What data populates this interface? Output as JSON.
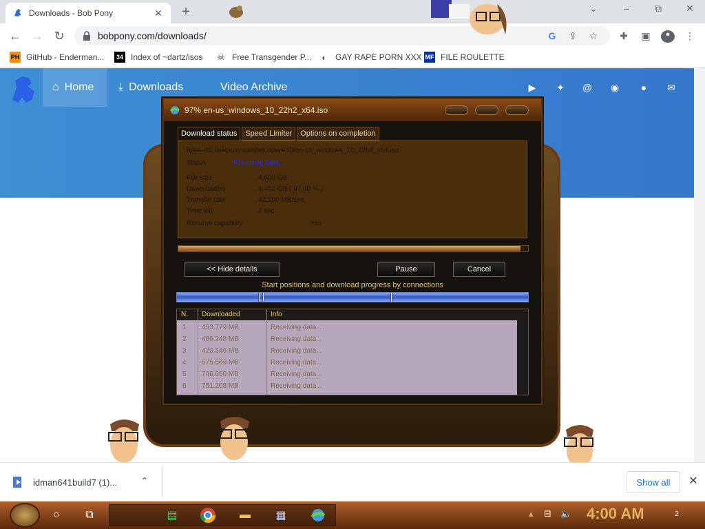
{
  "browser": {
    "tab_title": "Downloads - Bob Pony",
    "new_tab": "+",
    "window_controls": [
      "⌄",
      "–",
      "⧉",
      "✕"
    ],
    "url": "bobpony.com/downloads/",
    "bookmarks": [
      {
        "label": "GitHub - Enderman...",
        "icon": "PH",
        "icon_color": "#ff9000"
      },
      {
        "label": "Index of ~dartz/isos",
        "icon": "34",
        "icon_color": "#000000"
      },
      {
        "label": "Free Transgender P...",
        "icon": "☠",
        "icon_color": "#000000"
      },
      {
        "label": "GAY RAPE PORN XXX",
        "icon": "◐",
        "icon_color": "#5f6368"
      },
      {
        "label": "FILE ROULETTE",
        "icon": "MF",
        "icon_color": "#0033aa"
      }
    ]
  },
  "site": {
    "nav_home": "Home",
    "nav_downloads": "Downloads",
    "nav_archive": "Video Archive",
    "social_icons": [
      "youtube-icon",
      "twitter-icon",
      "mastodon-icon",
      "discord-icon",
      "github-icon",
      "mail-icon"
    ]
  },
  "idm": {
    "title": "97% en-us_windows_10_22h2_x64.iso",
    "tabs": [
      "Download status",
      "Speed Limiter",
      "Options on completion"
    ],
    "url": "https://dl.bobpony.com/windows/10/en-us_windows_10_22h2_x64.iso",
    "status_label": "Status",
    "status_value": "Receiving data...",
    "file_size_label": "File size",
    "file_size_value": "4.600  GB",
    "downloaded_label": "Downloaded",
    "downloaded_value": "4.402  GB  ( 97.80 % )",
    "transfer_rate_label": "Transfer rate",
    "transfer_rate_value": "42.560  MB/sec",
    "time_left_label": "Time left",
    "time_left_value": "2 sec",
    "resume_label": "Resume capability",
    "resume_value": "Yes",
    "progress_fraction": 0.978,
    "hide_details": "<< Hide details",
    "pause": "Pause",
    "cancel": "Cancel",
    "connections_caption": "Start positions and download progress by connections",
    "table_headers": [
      "N.",
      "Downloaded",
      "Info"
    ],
    "connections": [
      {
        "n": "1",
        "downloaded": "453.779  MB",
        "info": "Receiving data..."
      },
      {
        "n": "2",
        "downloaded": "486.248  MB",
        "info": "Receiving data..."
      },
      {
        "n": "3",
        "downloaded": "420.346  MB",
        "info": "Receiving data..."
      },
      {
        "n": "4",
        "downloaded": "575.569  MB",
        "info": "Receiving data..."
      },
      {
        "n": "5",
        "downloaded": "746.650  MB",
        "info": "Receiving data..."
      },
      {
        "n": "6",
        "downloaded": "751.208  MB",
        "info": "Receiving data..."
      }
    ]
  },
  "shelf": {
    "item_label": "idman641build7 (1)...",
    "show_all": "Show all"
  },
  "taskbar": {
    "clock": "4:00 AM",
    "notif_count": "2"
  }
}
